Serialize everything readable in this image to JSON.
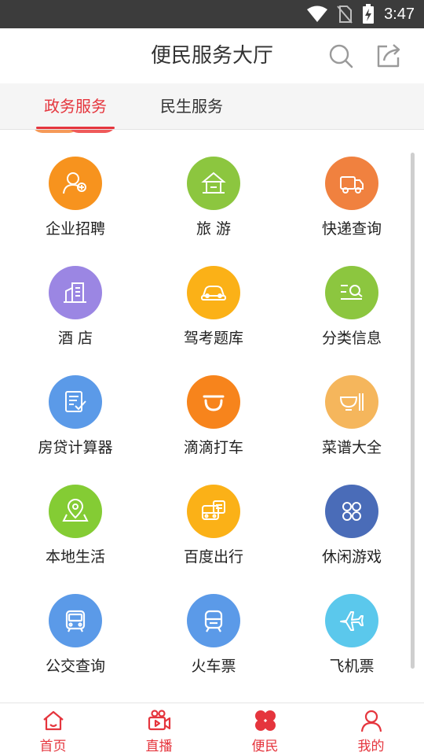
{
  "status_bar": {
    "time": "3:47",
    "icons": [
      "wifi-icon",
      "no-sim-icon",
      "battery-charging-icon"
    ]
  },
  "header": {
    "title": "便民服务大厅",
    "icons": [
      "search-icon",
      "share-icon"
    ]
  },
  "tabs": [
    {
      "label": "政务服务",
      "active": true
    },
    {
      "label": "民生服务",
      "active": false
    }
  ],
  "services": [
    {
      "label": "企业招聘",
      "color": "#f7931e",
      "icon": "person-add-icon"
    },
    {
      "label": "旅 游",
      "color": "#8cc63f",
      "icon": "pavilion-icon"
    },
    {
      "label": "快递查询",
      "color": "#f0813f",
      "icon": "delivery-truck-icon"
    },
    {
      "label": "酒 店",
      "color": "#9b86e3",
      "icon": "building-icon"
    },
    {
      "label": "驾考题库",
      "color": "#fbb117",
      "icon": "car-icon"
    },
    {
      "label": "分类信息",
      "color": "#8cc63f",
      "icon": "list-search-icon"
    },
    {
      "label": "房贷计算器",
      "color": "#5b9ae8",
      "icon": "document-check-icon"
    },
    {
      "label": "滴滴打车",
      "color": "#f7841c",
      "icon": "didi-icon"
    },
    {
      "label": "菜谱大全",
      "color": "#f5b65c",
      "icon": "bowl-utensils-icon"
    },
    {
      "label": "本地生活",
      "color": "#84cc34",
      "icon": "map-pin-icon"
    },
    {
      "label": "百度出行",
      "color": "#fbb117",
      "icon": "bus-front-icon"
    },
    {
      "label": "休闲游戏",
      "color": "#4a6cb8",
      "icon": "clover-grid-icon"
    },
    {
      "label": "公交查询",
      "color": "#5b9ae8",
      "icon": "bus-icon"
    },
    {
      "label": "火车票",
      "color": "#5b9ae8",
      "icon": "train-icon"
    },
    {
      "label": "飞机票",
      "color": "#5bc8ec",
      "icon": "airplane-icon"
    }
  ],
  "bottom_nav": [
    {
      "label": "首页",
      "icon": "home-icon"
    },
    {
      "label": "直播",
      "icon": "video-camera-icon"
    },
    {
      "label": "便民",
      "icon": "clover-icon",
      "active": true
    },
    {
      "label": "我的",
      "icon": "user-icon"
    }
  ],
  "colors": {
    "accent": "#e5353d",
    "status_bar": "#3c3c3c",
    "tab_bar": "#f5f5f5"
  }
}
